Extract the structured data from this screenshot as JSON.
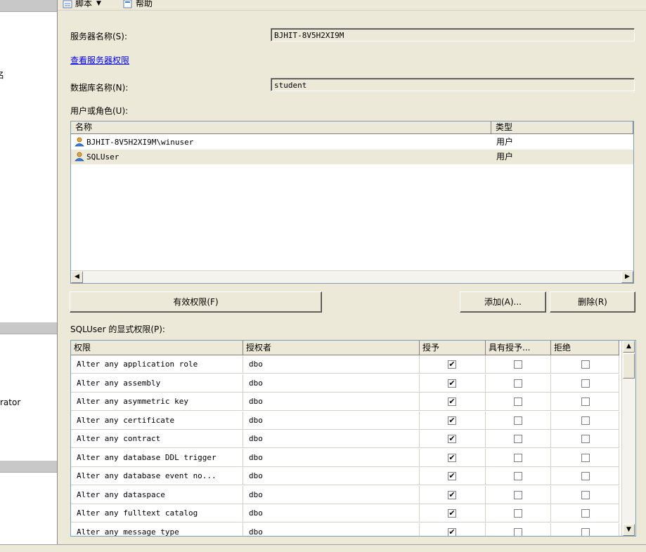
{
  "left_pane": {
    "partial_text_1": "名",
    "partial_text_2": "rator"
  },
  "toolbar": {
    "script_label": "脚本",
    "help_label": "帮助"
  },
  "form": {
    "server_name_label": "服务器名称(S):",
    "server_name_value": "BJHIT-8V5H2XI9M",
    "view_server_permissions_link": "查看服务器权限",
    "database_name_label": "数据库名称(N):",
    "database_name_value": "student",
    "users_roles_label": "用户或角色(U):"
  },
  "users_list": {
    "columns": [
      "名称",
      "类型"
    ],
    "rows": [
      {
        "name": "BJHIT-8V5H2XI9M\\winuser",
        "type": "用户"
      },
      {
        "name": "SQLUser",
        "type": "用户"
      }
    ]
  },
  "buttons": {
    "effective_permissions": "有效权限(F)",
    "add": "添加(A)...",
    "remove": "删除(R)"
  },
  "explicit_permissions": {
    "label": "SQLUser 的显式权限(P):",
    "columns": [
      "权限",
      "授权者",
      "授予",
      "具有授予...",
      "拒绝"
    ],
    "rows": [
      {
        "permission": "Alter any application role",
        "grantor": "dbo",
        "grant": true,
        "with_grant": false,
        "deny": false
      },
      {
        "permission": "Alter any assembly",
        "grantor": "dbo",
        "grant": true,
        "with_grant": false,
        "deny": false
      },
      {
        "permission": "Alter any asymmetric key",
        "grantor": "dbo",
        "grant": true,
        "with_grant": false,
        "deny": false
      },
      {
        "permission": "Alter any certificate",
        "grantor": "dbo",
        "grant": true,
        "with_grant": false,
        "deny": false
      },
      {
        "permission": "Alter any contract",
        "grantor": "dbo",
        "grant": true,
        "with_grant": false,
        "deny": false
      },
      {
        "permission": "Alter any database DDL trigger",
        "grantor": "dbo",
        "grant": true,
        "with_grant": false,
        "deny": false
      },
      {
        "permission": "Alter any database event no...",
        "grantor": "dbo",
        "grant": true,
        "with_grant": false,
        "deny": false
      },
      {
        "permission": "Alter any dataspace",
        "grantor": "dbo",
        "grant": true,
        "with_grant": false,
        "deny": false
      },
      {
        "permission": "Alter any fulltext catalog",
        "grantor": "dbo",
        "grant": true,
        "with_grant": false,
        "deny": false
      },
      {
        "permission": "Alter any message type",
        "grantor": "dbo",
        "grant": true,
        "with_grant": false,
        "deny": false
      }
    ]
  },
  "icons": {
    "script": "script-icon",
    "help": "help-icon",
    "user": "user-icon",
    "checked_glyph": "✔"
  },
  "colors": {
    "dialog_bg": "#ece9d8",
    "link": "#0000ee"
  }
}
